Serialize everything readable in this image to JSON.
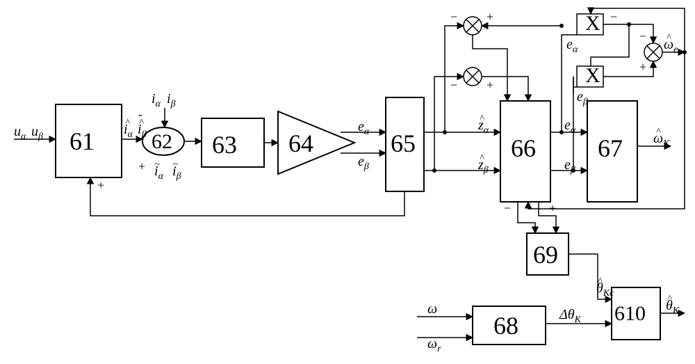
{
  "blocks": {
    "b61": "61",
    "b62": "62",
    "b63": "63",
    "b64": "64",
    "b65": "65",
    "b66": "66",
    "b67": "67",
    "b68": "68",
    "b69": "69",
    "b610": "610",
    "mult": "X"
  },
  "labels": {
    "u_alpha": "u",
    "u_beta": "u",
    "i_alpha": "i",
    "i_beta": "i",
    "e_alpha": "e",
    "e_beta": "e",
    "z_alpha": "z",
    "z_beta": "z",
    "omega_e": "ω",
    "omega_K": "ω",
    "theta_Kc": "θ",
    "theta_K": "θ",
    "delta_theta_K": "Δθ",
    "omega": "ω",
    "omega_r": "ω"
  },
  "subs": {
    "alpha": "α",
    "beta": "β",
    "K": "K",
    "Kc": "Kc",
    "e": "e",
    "r": "r"
  },
  "signs": {
    "plus": "+",
    "minus": "−",
    "minus2": "-"
  }
}
